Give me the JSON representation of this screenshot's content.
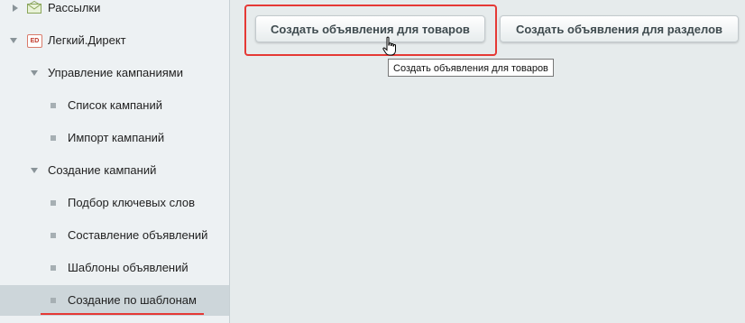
{
  "sidebar": {
    "items": [
      {
        "label": "Рассылки",
        "icon": "mail-icon"
      },
      {
        "label": "Легкий.Директ",
        "icon": "ed-icon",
        "icon_text": "ED"
      },
      {
        "label": "Управление кампаниями"
      },
      {
        "label": "Список кампаний"
      },
      {
        "label": "Импорт кампаний"
      },
      {
        "label": "Создание кампаний"
      },
      {
        "label": "Подбор ключевых слов"
      },
      {
        "label": "Составление объявлений"
      },
      {
        "label": "Шаблоны объявлений"
      },
      {
        "label": "Создание по шаблонам",
        "active": true
      }
    ]
  },
  "main": {
    "buttons": {
      "products": "Создать объявления для товаров",
      "sections": "Создать объявления для разделов"
    },
    "tooltip": "Создать объявления для товаров"
  },
  "colors": {
    "highlight": "#e53935",
    "sidebar_bg": "#edf1f3",
    "main_bg": "#e6ebec",
    "active_item": "#cdd6da"
  }
}
